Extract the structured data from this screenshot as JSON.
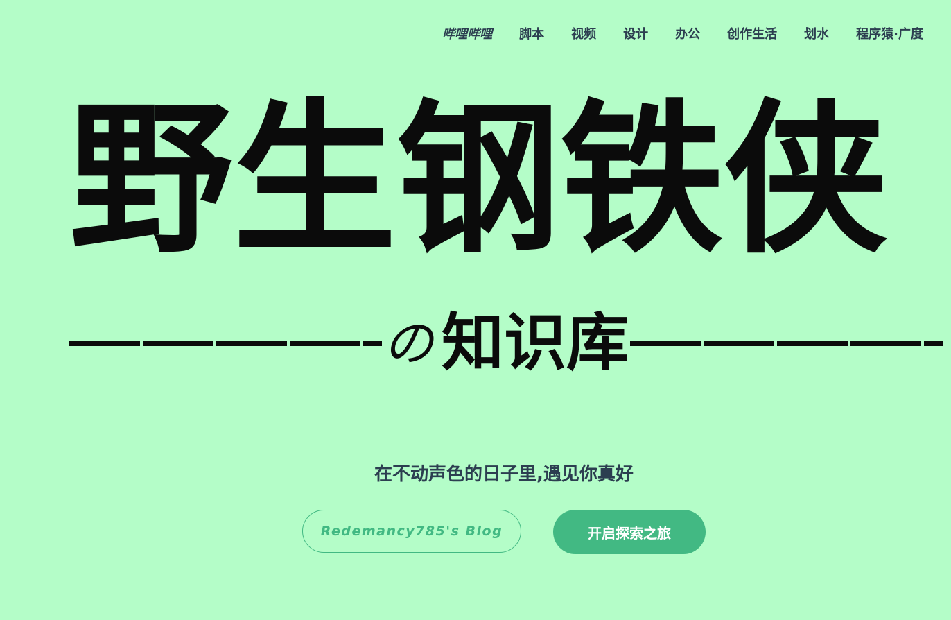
{
  "nav": {
    "items": [
      {
        "label": "哔哩哔哩"
      },
      {
        "label": "脚本"
      },
      {
        "label": "视频"
      },
      {
        "label": "设计"
      },
      {
        "label": "办公"
      },
      {
        "label": "创作生活"
      },
      {
        "label": "划水"
      },
      {
        "label": "程序猿·广度"
      }
    ]
  },
  "hero": {
    "title": "野生钢铁侠",
    "subtitle_particle": "の",
    "subtitle": "知识库",
    "tagline": "在不动声色的日子里,遇见你真好"
  },
  "actions": {
    "blog_label": "Redemancy785's Blog",
    "explore_label": "开启探索之旅"
  },
  "colors": {
    "background": "#b4fdc8",
    "accent": "#42b983",
    "nav_text": "#2c3e50",
    "title_text": "#0b0b0b"
  }
}
